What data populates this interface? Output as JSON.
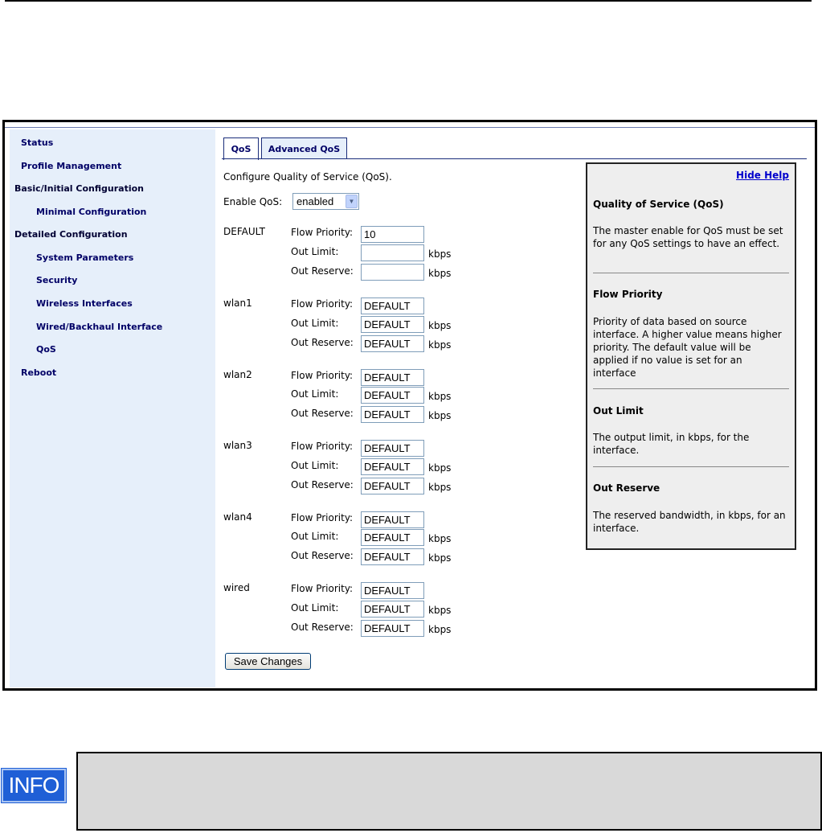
{
  "nav": {
    "items": [
      {
        "label": "Status"
      },
      {
        "label": "Profile Management"
      },
      {
        "label": "Basic/Initial Configuration"
      },
      {
        "label": "Minimal Configuration"
      },
      {
        "label": "Detailed Configuration"
      },
      {
        "label": "System Parameters"
      },
      {
        "label": "Security"
      },
      {
        "label": "Wireless Interfaces"
      },
      {
        "label": "Wired/Backhaul Interface"
      },
      {
        "label": "QoS"
      },
      {
        "label": "Reboot"
      }
    ]
  },
  "tabs": [
    {
      "label": "QoS",
      "active": true
    },
    {
      "label": "Advanced QoS",
      "active": false
    }
  ],
  "form": {
    "intro": "Configure Quality of Service (QoS).",
    "enable_label": "Enable QoS:",
    "enable_value": "enabled",
    "labels": {
      "flow_priority": "Flow Priority:",
      "out_limit": "Out Limit:",
      "out_reserve": "Out Reserve:",
      "unit": "kbps"
    },
    "groups": [
      {
        "name": "DEFAULT",
        "flow_priority": "10",
        "out_limit": "",
        "out_reserve": ""
      },
      {
        "name": "wlan1",
        "flow_priority": "DEFAULT",
        "out_limit": "DEFAULT",
        "out_reserve": "DEFAULT"
      },
      {
        "name": "wlan2",
        "flow_priority": "DEFAULT",
        "out_limit": "DEFAULT",
        "out_reserve": "DEFAULT"
      },
      {
        "name": "wlan3",
        "flow_priority": "DEFAULT",
        "out_limit": "DEFAULT",
        "out_reserve": "DEFAULT"
      },
      {
        "name": "wlan4",
        "flow_priority": "DEFAULT",
        "out_limit": "DEFAULT",
        "out_reserve": "DEFAULT"
      },
      {
        "name": "wired",
        "flow_priority": "DEFAULT",
        "out_limit": "DEFAULT",
        "out_reserve": "DEFAULT"
      }
    ],
    "save_label": "Save Changes"
  },
  "help": {
    "hide_label": "Hide Help",
    "sections": [
      {
        "title": "Quality of Service (QoS)",
        "body": "The master enable for QoS must be set for any QoS settings to have an effect."
      },
      {
        "title": "Flow Priority",
        "body": "Priority of data based on source interface. A higher value means higher priority. The default value will be applied if no value is set for an interface"
      },
      {
        "title": "Out Limit",
        "body": "The output limit, in kbps, for the interface."
      },
      {
        "title": "Out Reserve",
        "body": "The reserved bandwidth, in kbps, for an interface."
      }
    ]
  },
  "info": {
    "icon_label": "INFO",
    "icon": "info-icon"
  }
}
